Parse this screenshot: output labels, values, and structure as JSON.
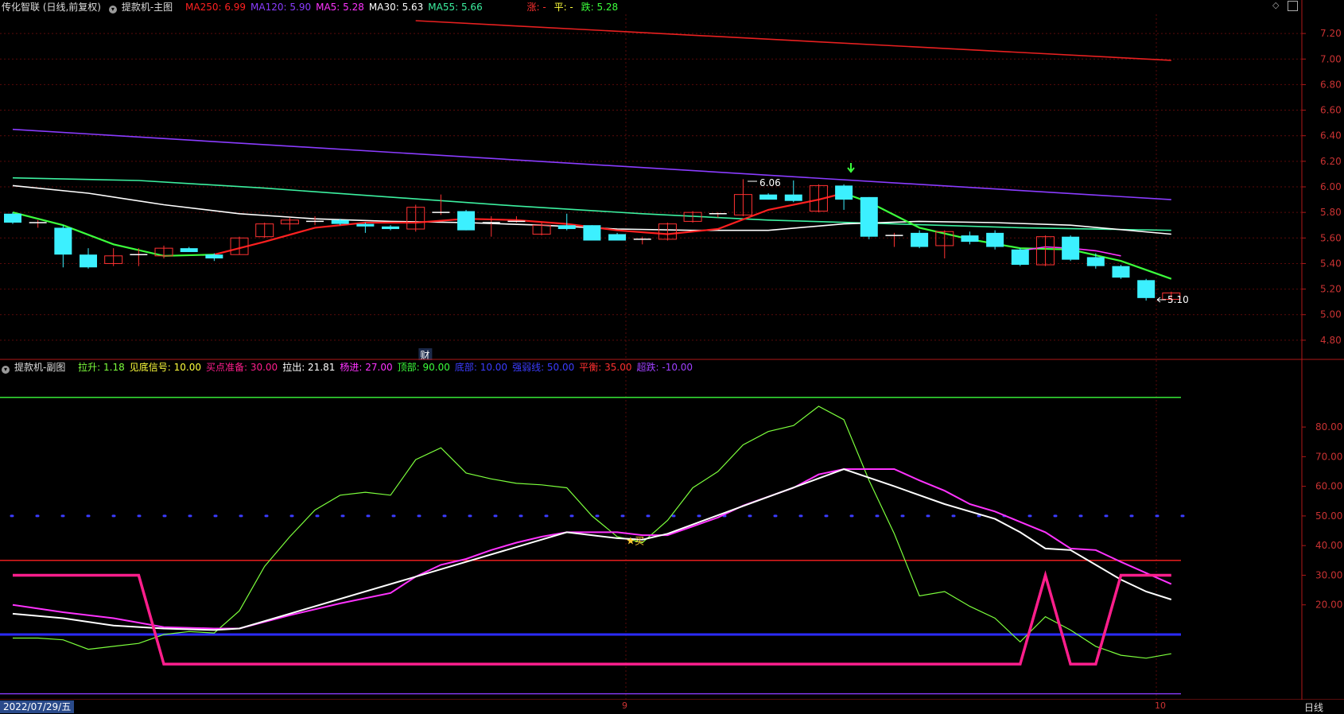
{
  "header": {
    "stock_name": "传化智联 (日线,前复权)",
    "main_indicator": "提款机-主图",
    "ma_items": [
      {
        "label": "MA250: 6.99",
        "color": "#ff2020"
      },
      {
        "label": "MA120: 5.90",
        "color": "#8a3cff"
      },
      {
        "label": "MA5: 5.28",
        "color": "#ff33ff"
      },
      {
        "label": "MA30: 5.63",
        "color": "#ffffff"
      },
      {
        "label": "MA55: 5.66",
        "color": "#3cf0a0"
      }
    ],
    "zhang": "涨: -",
    "ping": "平: -",
    "die": "跌: 5.28"
  },
  "sub_header": {
    "indicator": "提款机-副图",
    "items": [
      {
        "label": "拉升: 1.18",
        "color": "#7cff3c"
      },
      {
        "label": "见底信号: 10.00",
        "color": "#ffff3c"
      },
      {
        "label": "买点准备: 30.00",
        "color": "#ff1e8c"
      },
      {
        "label": "拉出: 21.81",
        "color": "#ffffff"
      },
      {
        "label": "杨进: 27.00",
        "color": "#ff33ff"
      },
      {
        "label": "顶部: 90.00",
        "color": "#3cff3c"
      },
      {
        "label": "底部: 10.00",
        "color": "#3c3cff"
      },
      {
        "label": "强弱线: 50.00",
        "color": "#3c3cff"
      },
      {
        "label": "平衡: 35.00",
        "color": "#ff3030"
      },
      {
        "label": "超跌: -10.00",
        "color": "#a040ff"
      }
    ]
  },
  "bottom": {
    "date": "2022/07/29/五",
    "month_labels": [
      "9",
      "10"
    ],
    "period": "日线"
  },
  "annotations": {
    "high_label": "6.06",
    "low_label": "5.10",
    "cai_label": "财",
    "buy_label": "买"
  },
  "chart_data": [
    {
      "type": "candlestick",
      "title": "提款机-主图",
      "ylim": [
        4.65,
        7.35
      ],
      "y_ticks": [
        "7.20",
        "7.00",
        "6.80",
        "6.60",
        "6.40",
        "6.20",
        "6.00",
        "5.80",
        "5.60",
        "5.40",
        "5.20",
        "5.00",
        "4.80"
      ],
      "candles": [
        {
          "o": 5.79,
          "c": 5.72,
          "h": 5.8,
          "l": 5.71
        },
        {
          "o": 5.72,
          "c": 5.72,
          "h": 5.74,
          "l": 5.68
        },
        {
          "o": 5.68,
          "c": 5.47,
          "h": 5.7,
          "l": 5.37
        },
        {
          "o": 5.47,
          "c": 5.37,
          "h": 5.52,
          "l": 5.36
        },
        {
          "o": 5.4,
          "c": 5.46,
          "h": 5.52,
          "l": 5.38
        },
        {
          "o": 5.47,
          "c": 5.47,
          "h": 5.52,
          "l": 5.38
        },
        {
          "o": 5.46,
          "c": 5.52,
          "h": 5.54,
          "l": 5.44
        },
        {
          "o": 5.52,
          "c": 5.49,
          "h": 5.53,
          "l": 5.49
        },
        {
          "o": 5.47,
          "c": 5.44,
          "h": 5.48,
          "l": 5.42
        },
        {
          "o": 5.47,
          "c": 5.6,
          "h": 5.61,
          "l": 5.47
        },
        {
          "o": 5.61,
          "c": 5.71,
          "h": 5.72,
          "l": 5.6
        },
        {
          "o": 5.71,
          "c": 5.74,
          "h": 5.76,
          "l": 5.66
        },
        {
          "o": 5.73,
          "c": 5.73,
          "h": 5.77,
          "l": 5.7
        },
        {
          "o": 5.74,
          "c": 5.71,
          "h": 5.75,
          "l": 5.7
        },
        {
          "o": 5.71,
          "c": 5.69,
          "h": 5.72,
          "l": 5.64
        },
        {
          "o": 5.69,
          "c": 5.67,
          "h": 5.7,
          "l": 5.66
        },
        {
          "o": 5.67,
          "c": 5.84,
          "h": 5.86,
          "l": 5.65
        },
        {
          "o": 5.8,
          "c": 5.8,
          "h": 5.94,
          "l": 5.78
        },
        {
          "o": 5.81,
          "c": 5.66,
          "h": 5.82,
          "l": 5.66
        },
        {
          "o": 5.72,
          "c": 5.72,
          "h": 5.77,
          "l": 5.61
        },
        {
          "o": 5.73,
          "c": 5.73,
          "h": 5.77,
          "l": 5.72
        },
        {
          "o": 5.63,
          "c": 5.7,
          "h": 5.72,
          "l": 5.62
        },
        {
          "o": 5.7,
          "c": 5.67,
          "h": 5.79,
          "l": 5.66
        },
        {
          "o": 5.7,
          "c": 5.58,
          "h": 5.7,
          "l": 5.58
        },
        {
          "o": 5.63,
          "c": 5.58,
          "h": 5.64,
          "l": 5.58
        },
        {
          "o": 5.59,
          "c": 5.59,
          "h": 5.61,
          "l": 5.55
        },
        {
          "o": 5.59,
          "c": 5.71,
          "h": 5.72,
          "l": 5.58
        },
        {
          "o": 5.73,
          "c": 5.8,
          "h": 5.81,
          "l": 5.72
        },
        {
          "o": 5.79,
          "c": 5.79,
          "h": 5.8,
          "l": 5.76
        },
        {
          "o": 5.78,
          "c": 5.94,
          "h": 6.06,
          "l": 5.77
        },
        {
          "o": 5.94,
          "c": 5.9,
          "h": 5.95,
          "l": 5.9
        },
        {
          "o": 5.94,
          "c": 5.89,
          "h": 6.05,
          "l": 5.88
        },
        {
          "o": 5.81,
          "c": 6.01,
          "h": 6.02,
          "l": 5.8
        },
        {
          "o": 6.01,
          "c": 5.9,
          "h": 6.02,
          "l": 5.82
        },
        {
          "o": 5.92,
          "c": 5.61,
          "h": 5.92,
          "l": 5.59
        },
        {
          "o": 5.62,
          "c": 5.62,
          "h": 5.64,
          "l": 5.53
        },
        {
          "o": 5.64,
          "c": 5.53,
          "h": 5.66,
          "l": 5.52
        },
        {
          "o": 5.54,
          "c": 5.65,
          "h": 5.66,
          "l": 5.44
        },
        {
          "o": 5.62,
          "c": 5.57,
          "h": 5.65,
          "l": 5.55
        },
        {
          "o": 5.64,
          "c": 5.53,
          "h": 5.66,
          "l": 5.51
        },
        {
          "o": 5.51,
          "c": 5.39,
          "h": 5.52,
          "l": 5.38
        },
        {
          "o": 5.39,
          "c": 5.61,
          "h": 5.62,
          "l": 5.38
        },
        {
          "o": 5.61,
          "c": 5.43,
          "h": 5.62,
          "l": 5.42
        },
        {
          "o": 5.45,
          "c": 5.38,
          "h": 5.48,
          "l": 5.36
        },
        {
          "o": 5.38,
          "c": 5.29,
          "h": 5.39,
          "l": 5.28
        },
        {
          "o": 5.27,
          "c": 5.13,
          "h": 5.28,
          "l": 5.11
        },
        {
          "o": 5.12,
          "c": 5.17,
          "h": 5.18,
          "l": 5.11
        }
      ],
      "series": [
        {
          "name": "MA250",
          "color": "#e82020",
          "x": [
            16,
            46
          ],
          "values": [
            7.3,
            6.99
          ]
        },
        {
          "name": "MA120",
          "color": "#8a3cff",
          "x": [
            0,
            46
          ],
          "values": [
            6.45,
            5.9
          ]
        },
        {
          "name": "MA55",
          "color": "#3cf0a0",
          "x": [
            0,
            5,
            10,
            15,
            20,
            25,
            30,
            35,
            40,
            46
          ],
          "values": [
            6.07,
            6.05,
            5.99,
            5.92,
            5.85,
            5.79,
            5.74,
            5.71,
            5.68,
            5.66
          ]
        },
        {
          "name": "MA30",
          "color": "#ffffff",
          "x": [
            0,
            3,
            6,
            9,
            12,
            15,
            18,
            21,
            24,
            27,
            30,
            33,
            36,
            39,
            42,
            46
          ],
          "values": [
            6.01,
            5.95,
            5.86,
            5.79,
            5.75,
            5.73,
            5.72,
            5.7,
            5.67,
            5.66,
            5.66,
            5.71,
            5.73,
            5.72,
            5.7,
            5.63
          ]
        },
        {
          "name": "MA5_down",
          "color": "#3cff3c",
          "x": [
            0,
            2,
            4,
            6,
            8
          ],
          "values": [
            5.8,
            5.7,
            5.55,
            5.46,
            5.47
          ]
        },
        {
          "name": "MA5_up",
          "color": "#ff2020",
          "x": [
            8,
            10,
            12,
            14,
            16,
            18,
            20,
            22,
            24,
            26,
            28,
            30,
            32,
            33
          ],
          "values": [
            5.47,
            5.57,
            5.68,
            5.72,
            5.72,
            5.75,
            5.74,
            5.71,
            5.66,
            5.63,
            5.67,
            5.82,
            5.9,
            5.95
          ]
        },
        {
          "name": "MA5_down2",
          "color": "#3cff3c",
          "x": [
            33,
            34,
            36,
            38,
            40,
            42,
            44,
            46
          ],
          "values": [
            5.95,
            5.88,
            5.68,
            5.59,
            5.52,
            5.51,
            5.42,
            5.28
          ]
        },
        {
          "name": "MA5_pink",
          "color": "#ff33ff",
          "x": [
            40,
            41,
            42,
            43,
            44
          ],
          "values": [
            5.5,
            5.53,
            5.52,
            5.5,
            5.46
          ]
        }
      ]
    },
    {
      "type": "line",
      "title": "提款机-副图",
      "ylim": [
        -12,
        98
      ],
      "y_ticks": [
        "80.00",
        "70.00",
        "60.00",
        "50.00",
        "40.00",
        "30.00",
        "20.00"
      ],
      "hlines": [
        {
          "name": "顶部",
          "value": 90,
          "color": "#3cff3c"
        },
        {
          "name": "强弱线",
          "value": 50,
          "color": "#3c3cff",
          "dotted": true
        },
        {
          "name": "平衡",
          "value": 35,
          "color": "#ff2020"
        },
        {
          "name": "底部",
          "value": 10,
          "color": "#2b2bff",
          "width": 3
        },
        {
          "name": "超跌",
          "value": -10,
          "color": "#8a3cff"
        }
      ],
      "series": [
        {
          "name": "拉升",
          "color": "#7cff3c",
          "x": [
            0,
            1,
            2,
            3,
            4,
            5,
            6,
            7,
            8,
            9,
            10,
            11,
            12,
            13,
            14,
            15,
            16,
            17,
            18,
            19,
            20,
            21,
            22,
            23,
            24,
            25,
            26,
            27,
            28,
            29,
            30,
            31,
            32,
            33,
            34,
            35,
            36,
            37,
            38,
            39,
            40,
            41,
            42,
            43,
            44,
            45,
            46
          ],
          "values": [
            8.8,
            8.8,
            8.2,
            5.0,
            6.0,
            7.0,
            10.0,
            11.0,
            10.5,
            18.0,
            33.0,
            43.0,
            52.0,
            57.0,
            58.0,
            57.0,
            69.0,
            73.0,
            64.5,
            62.5,
            61.0,
            60.5,
            59.5,
            50.0,
            43.0,
            41.0,
            48.5,
            59.5,
            65.0,
            74.0,
            78.5,
            80.5,
            87.0,
            82.5,
            62.0,
            44.0,
            23.0,
            24.5,
            19.5,
            15.5,
            7.5,
            16.0,
            11.5,
            6.0,
            3.0,
            2.0,
            3.5
          ]
        },
        {
          "name": "杨进",
          "color": "#ff33ff",
          "x": [
            0,
            2,
            4,
            6,
            8,
            9,
            11,
            13,
            15,
            16,
            17,
            18,
            19,
            20,
            21,
            22,
            23,
            24,
            25,
            26,
            27,
            28,
            29,
            30,
            31,
            32,
            33,
            34,
            35,
            36,
            37,
            38,
            39,
            40,
            41,
            42,
            43,
            44,
            46
          ],
          "values": [
            20.0,
            17.5,
            15.5,
            12.5,
            12.0,
            12.0,
            16.5,
            20.5,
            24.0,
            29.5,
            33.5,
            35.5,
            38.5,
            41.0,
            43.0,
            44.5,
            44.5,
            44.5,
            43.5,
            43.5,
            46.5,
            49.5,
            53.5,
            56.5,
            59.5,
            64.0,
            65.8,
            65.8,
            65.8,
            62.0,
            58.5,
            54.0,
            51.5,
            48.0,
            44.5,
            39.0,
            38.5,
            34.5,
            27.0
          ]
        },
        {
          "name": "拉出",
          "color": "#ffffff",
          "x": [
            0,
            2,
            4,
            6,
            8,
            9,
            22,
            24,
            25,
            26,
            33,
            35,
            37,
            39,
            40,
            41,
            42,
            43,
            44,
            45,
            46
          ],
          "values": [
            17.0,
            15.5,
            13.0,
            12.0,
            11.5,
            12.0,
            44.5,
            42.5,
            42.0,
            44.0,
            65.8,
            60.0,
            54.0,
            49.0,
            44.5,
            39.0,
            38.5,
            33.5,
            28.5,
            24.5,
            21.8
          ]
        },
        {
          "name": "买点准备",
          "color": "#ff1e8c",
          "x": [
            0,
            5,
            6,
            40,
            41,
            42,
            43,
            44,
            46
          ],
          "values": [
            30,
            30,
            0,
            0,
            30,
            0,
            0,
            30,
            30
          ]
        }
      ]
    }
  ]
}
